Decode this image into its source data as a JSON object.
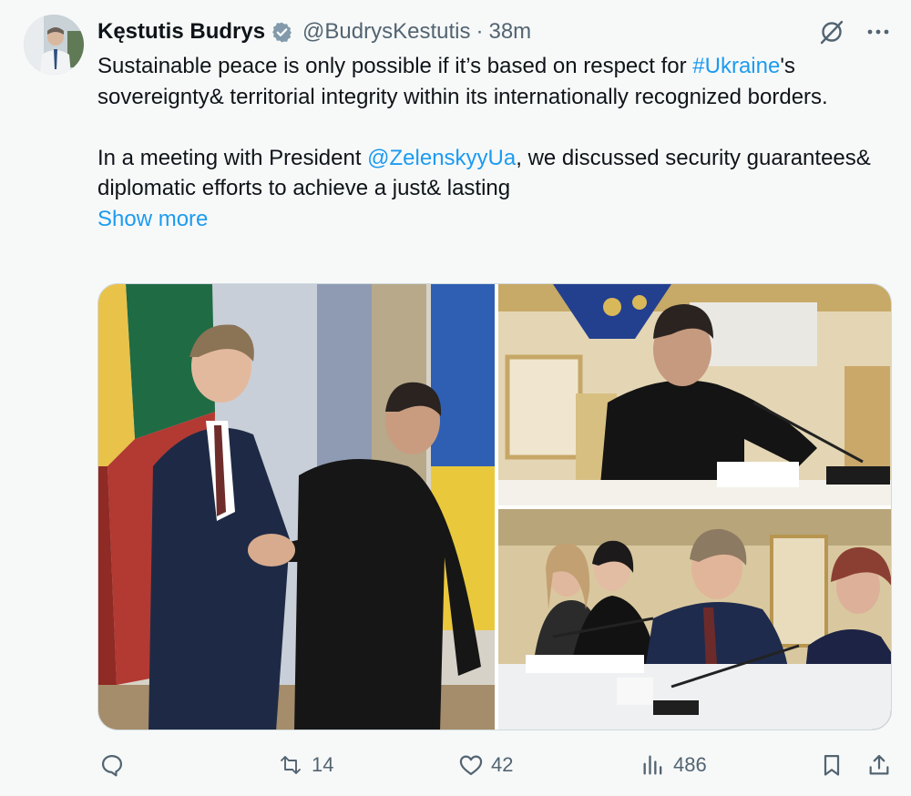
{
  "author": {
    "display_name": "Kęstutis Budrys",
    "handle": "@BudrysKestutis",
    "separator": "·",
    "time": "38m"
  },
  "icons": {
    "verified": "verified-badge-icon",
    "grok": "grok-icon",
    "more": "more-icon",
    "reply": "reply-icon",
    "retweet": "retweet-icon",
    "like": "like-icon",
    "views": "views-icon",
    "bookmark": "bookmark-icon",
    "share": "share-icon"
  },
  "colors": {
    "accent": "#1d9bf0",
    "secondary_text": "#536471",
    "primary_text": "#0f1419",
    "background": "#f7f9f9"
  },
  "text": {
    "p1_before": "Sustainable peace is only possible if it’s based on respect for ",
    "p1_hashtag": "#Ukraine",
    "p1_after": "'s sovereignty& territorial integrity within its internationally recognized borders.",
    "p2_before": "In a meeting with President ",
    "p2_mention": "@ZelenskyyUa",
    "p2_after": ", we discussed security guarantees& diplomatic efforts to achieve a just& lasting",
    "show_more": "Show more"
  },
  "engagement": {
    "replies": "",
    "retweets": "14",
    "likes": "42",
    "views": "486"
  }
}
